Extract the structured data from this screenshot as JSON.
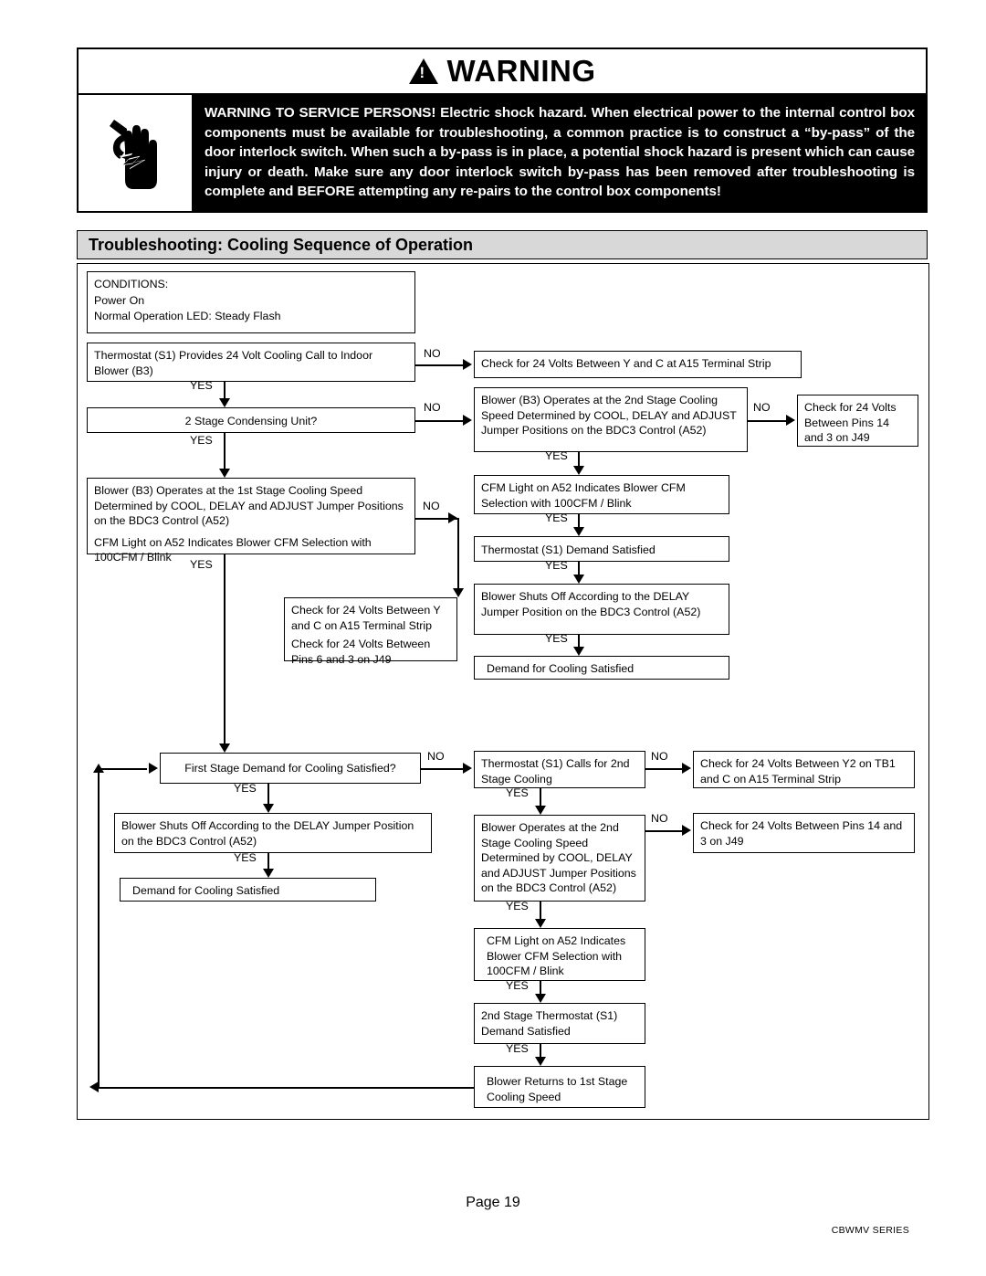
{
  "warning": {
    "icon": "electric-shock-hand-icon",
    "title_icon": "warning-triangle-icon",
    "title": "WARNING",
    "body": "WARNING TO SERVICE PERSONS! Electric shock hazard.  When electrical power to the internal control box components must be available for troubleshooting, a common practice is to construct a “by-pass” of the door interlock switch. When such a by-pass is in place, a potential shock hazard is present which can cause injury or death. Make sure any door interlock switch by-pass has been removed after troubleshooting is complete and BEFORE attempting any re-pairs to the control box components!"
  },
  "section": {
    "title": "Troubleshooting:  Cooling Sequence of Operation"
  },
  "flowchart": {
    "edge_labels": {
      "yes": "YES",
      "no": "NO"
    },
    "boxes": {
      "conditions": {
        "line1": "CONDITIONS:",
        "line2": "Power On",
        "line3": "Normal Operation LED:  Steady Flash"
      },
      "thermostat_call": "Thermostat (S1) Provides 24 Volt Cooling Call to Indoor Blower (B3)",
      "check_y_c_a15": "Check for 24 Volts Between Y and C at A15 Terminal Strip",
      "two_stage_unit": "2 Stage Condensing Unit?",
      "blower_2nd_stage_top": "Blower (B3) Operates at the 2nd Stage Cooling Speed Determined by COOL, DELAY and ADJUST Jumper Positions on the BDC3 Control (A52)",
      "check_pins_14_3_top": "Check for 24 Volts Between Pins 14 and 3 on J49",
      "blower_1st_stage_a": "Blower (B3) Operates at the 1st Stage Cooling Speed Determined by COOL, DELAY and ADJUST Jumper Positions on the BDC3 Control (A52)",
      "blower_1st_stage_b": "CFM Light on A52 Indicates Blower CFM Selection with 100CFM / Blink",
      "cfm_light_top": "CFM Light on A52 Indicates Blower CFM Selection with 100CFM / Blink",
      "thermostat_satisfied_top": "Thermostat (S1) Demand Satisfied",
      "check_volts_dual_a": "Check for 24 Volts Between Y and C on A15 Terminal Strip",
      "check_volts_dual_b": "Check for 24 Volts Between Pins 6 and 3 on J49",
      "blower_shuts_off_top": "Blower Shuts Off According to the DELAY Jumper Position on the BDC3 Control (A52)",
      "demand_satisfied_top": "Demand for Cooling Satisfied",
      "first_stage_demand": "First Stage Demand for Cooling Satisfied?",
      "thermostat_calls_2nd": "Thermostat (S1) Calls for 2nd Stage Cooling",
      "check_y2_tb1": "Check for 24 Volts Between Y2 on TB1 and C on A15 Terminal Strip",
      "blower_shuts_off_bottom": "Blower Shuts Off According to the DELAY Jumper Position on the BDC3 Control (A52)",
      "blower_operates_2nd": "Blower Operates at the 2nd Stage Cooling Speed Determined by COOL, DELAY and ADJUST Jumper Positions on the BDC3 Control (A52)",
      "check_pins_14_3_bottom": "Check for 24 Volts Between Pins 14 and 3 on J49",
      "demand_satisfied_bottom": "Demand for Cooling Satisfied",
      "cfm_light_bottom": "CFM Light on A52 Indicates Blower CFM Selection with 100CFM / Blink",
      "thermostat_2nd_satisfied": "2nd Stage Thermostat (S1) Demand Satisfied",
      "blower_returns_1st": "Blower Returns to 1st Stage Cooling Speed"
    }
  },
  "footer": {
    "page": "Page  19",
    "series": "CBWMV SERIES"
  }
}
